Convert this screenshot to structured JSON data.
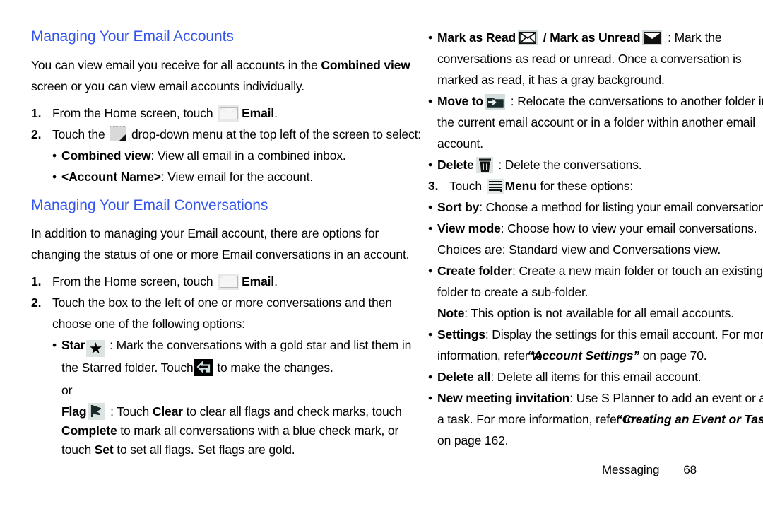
{
  "document": {
    "footer": {
      "chapter": "Messaging",
      "page_number": "68"
    }
  },
  "left_column": {
    "heading1": "Managing Your Email Accounts",
    "intro": {
      "part1": "You can view email you receive for all accounts in the ",
      "bold1": "Combined view",
      "part2": " screen or you can view email accounts individually."
    },
    "step1": {
      "number": "1.",
      "text_before": "From the Home screen, touch ",
      "icon": "email-icon",
      "bold": "Email",
      "text_after": "."
    },
    "step2": {
      "number": "2.",
      "text_before": "Touch the ",
      "icon": "dropdown-icon",
      "text_after": " drop-down menu at the top left of the screen to select:"
    },
    "step2_bullets": [
      {
        "bold": "Combined view",
        "rest": ": View all email in a combined inbox."
      },
      {
        "bold": "<Account Name>",
        "rest": ": View email for the account."
      }
    ],
    "heading2": "Managing Your Email Conversations",
    "intro2": "In addition to managing your Email account, there are options for changing the status of one or more Email conversations in an account.",
    "step3": {
      "number": "1.",
      "text_before": "From the Home screen, touch ",
      "icon": "email-icon",
      "bold": "Email",
      "text_after": "."
    },
    "step4": {
      "number": "2.",
      "text": "Touch the box to the left of one or more conversations and then choose one of the following options:"
    },
    "star_bullet": {
      "bold": "Star",
      "icon": "star-icon",
      "text_before": " : Mark the conversations with a gold star and list them in the Starred folder. ",
      "touch_word": "Touch",
      "icon2": "back-arrow-icon",
      "text_after": " to make the changes."
    },
    "or_label": "or",
    "flag_bullet": {
      "bold": "Flag",
      "icon": "flag-icon",
      "seg1": " : Touch ",
      "bold_clear": "Clear",
      "seg2": " to clear all flags and check marks, touch ",
      "bold_complete": "Complete",
      "seg3": " to mark all conversations with a blue check mark, or touch ",
      "bold_set": "Set",
      "seg4": " to set all flags. Set flags are gold."
    }
  },
  "right_column": {
    "mark_read_bullet": {
      "bold1": "Mark as Read",
      "icon1": "envelope-open-icon",
      "separator": " / ",
      "bold2": "Mark as Unread",
      "icon2": "envelope-closed-icon",
      "rest": " : Mark the conversations as read or unread. Once a conversation is marked as read, it has a gray background."
    },
    "move_to_bullet": {
      "bold": "Move to",
      "icon": "folder-move-icon",
      "rest": " : Relocate the conversations to another folder in the current email account or in a folder within another email account."
    },
    "delete_bullet": {
      "bold": "Delete",
      "icon": "trash-icon",
      "rest": " : Delete the conversations."
    },
    "step3": {
      "number": "3.",
      "text_before": "Touch ",
      "icon": "menu-icon",
      "bold": "Menu",
      "text_after": " for these options:"
    },
    "menu_bullets": [
      {
        "bold": "Sort by",
        "rest": ": Choose a method for listing your email conversations."
      },
      {
        "bold": "View mode",
        "rest": ": Choose how to view your email conversations. Choices are: Standard view and Conversations view."
      },
      {
        "bold": "Create folder",
        "rest": ": Create a new main folder or touch an existing folder to create a sub-folder."
      }
    ],
    "note": {
      "bold": "Note",
      "rest": ": This option is not available for all email accounts."
    },
    "settings_bullet": {
      "bold": "Settings",
      "seg1": ": Display the settings for this email account. For more information, refer to ",
      "link": "“Account Settings”",
      "seg2": " on page 70."
    },
    "delete_all_bullet": {
      "bold": "Delete all",
      "rest": ": Delete all items for this email account."
    },
    "meeting_bullet": {
      "bold": "New meeting invitation",
      "seg1": ": Use S Planner to add an event or add a task. For more information, refer to ",
      "link": "“Creating an Event or Task”",
      "seg2": " on page 162."
    }
  },
  "colors": {
    "heading": "#3355ee",
    "body_text": "#000000",
    "page_background": "#ffffff"
  }
}
